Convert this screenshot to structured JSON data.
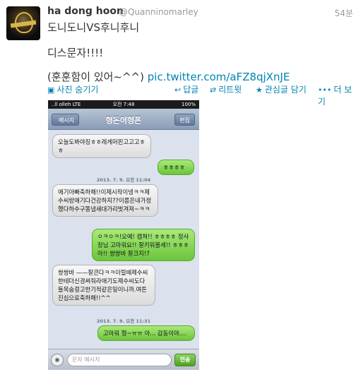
{
  "tweet": {
    "display_name": "ha dong hoon",
    "handle": "@Quanninomarley",
    "time": "54분",
    "text_line1": "도니도니VS후니후니",
    "text_line2": "디스문자!!!!",
    "text_line3": "(훈훈함이 있어~^^)",
    "link": "pic.twitter.com/aFZ8qjXnJE"
  },
  "actions": {
    "hide_photo": "사진 숨기기",
    "reply": "답글",
    "retweet": "리트윗",
    "favorite": "관심글 담기",
    "more": "더 보기"
  },
  "phone": {
    "status": {
      "carrier": "..ll olleh  LTE",
      "clock": "오전 7:48",
      "battery": "100%"
    },
    "nav": {
      "back": "메시지",
      "title": "형돈이형폰",
      "edit": "편집"
    },
    "messages": {
      "m1": "오늘도봐야징ㅎㅎ레게머핀고고고ㅎㅎ",
      "m2": "ㅎㅎㅎㅎ",
      "stamp1": "2013. 7. 9. 오전 11:04",
      "m3": "애기아빠축하해!!이제시작이넹ㅋㅋ제수씨랑애기다건강하지??이름은내가정했다하수구똥냄새대가리벗겨져~ㅋㅋ",
      "m4": "ㅇㅋㅇㅋ!오예! 캡쳐!! ㅎㅎㅎㅎ 정사장님 고마워요!! 잘키워볼세!! ㅎㅎㅎ 아!! 쌍쌍바 잘크지!?",
      "m5": "쌍쌍바 ——잘큰다ㅋㅋ이럴때제수씨한테더신경써줘라애기도제수씨도다들목숨걸고한기적같은일이니까.여튼진심으로축하해!!^^",
      "stamp2": "2013. 7. 9. 오전 11:31",
      "m6": "고마워 형~ㅠㅠ 아... 감동이야...."
    },
    "input": {
      "placeholder": "문자 메시지",
      "send": "전송"
    }
  }
}
